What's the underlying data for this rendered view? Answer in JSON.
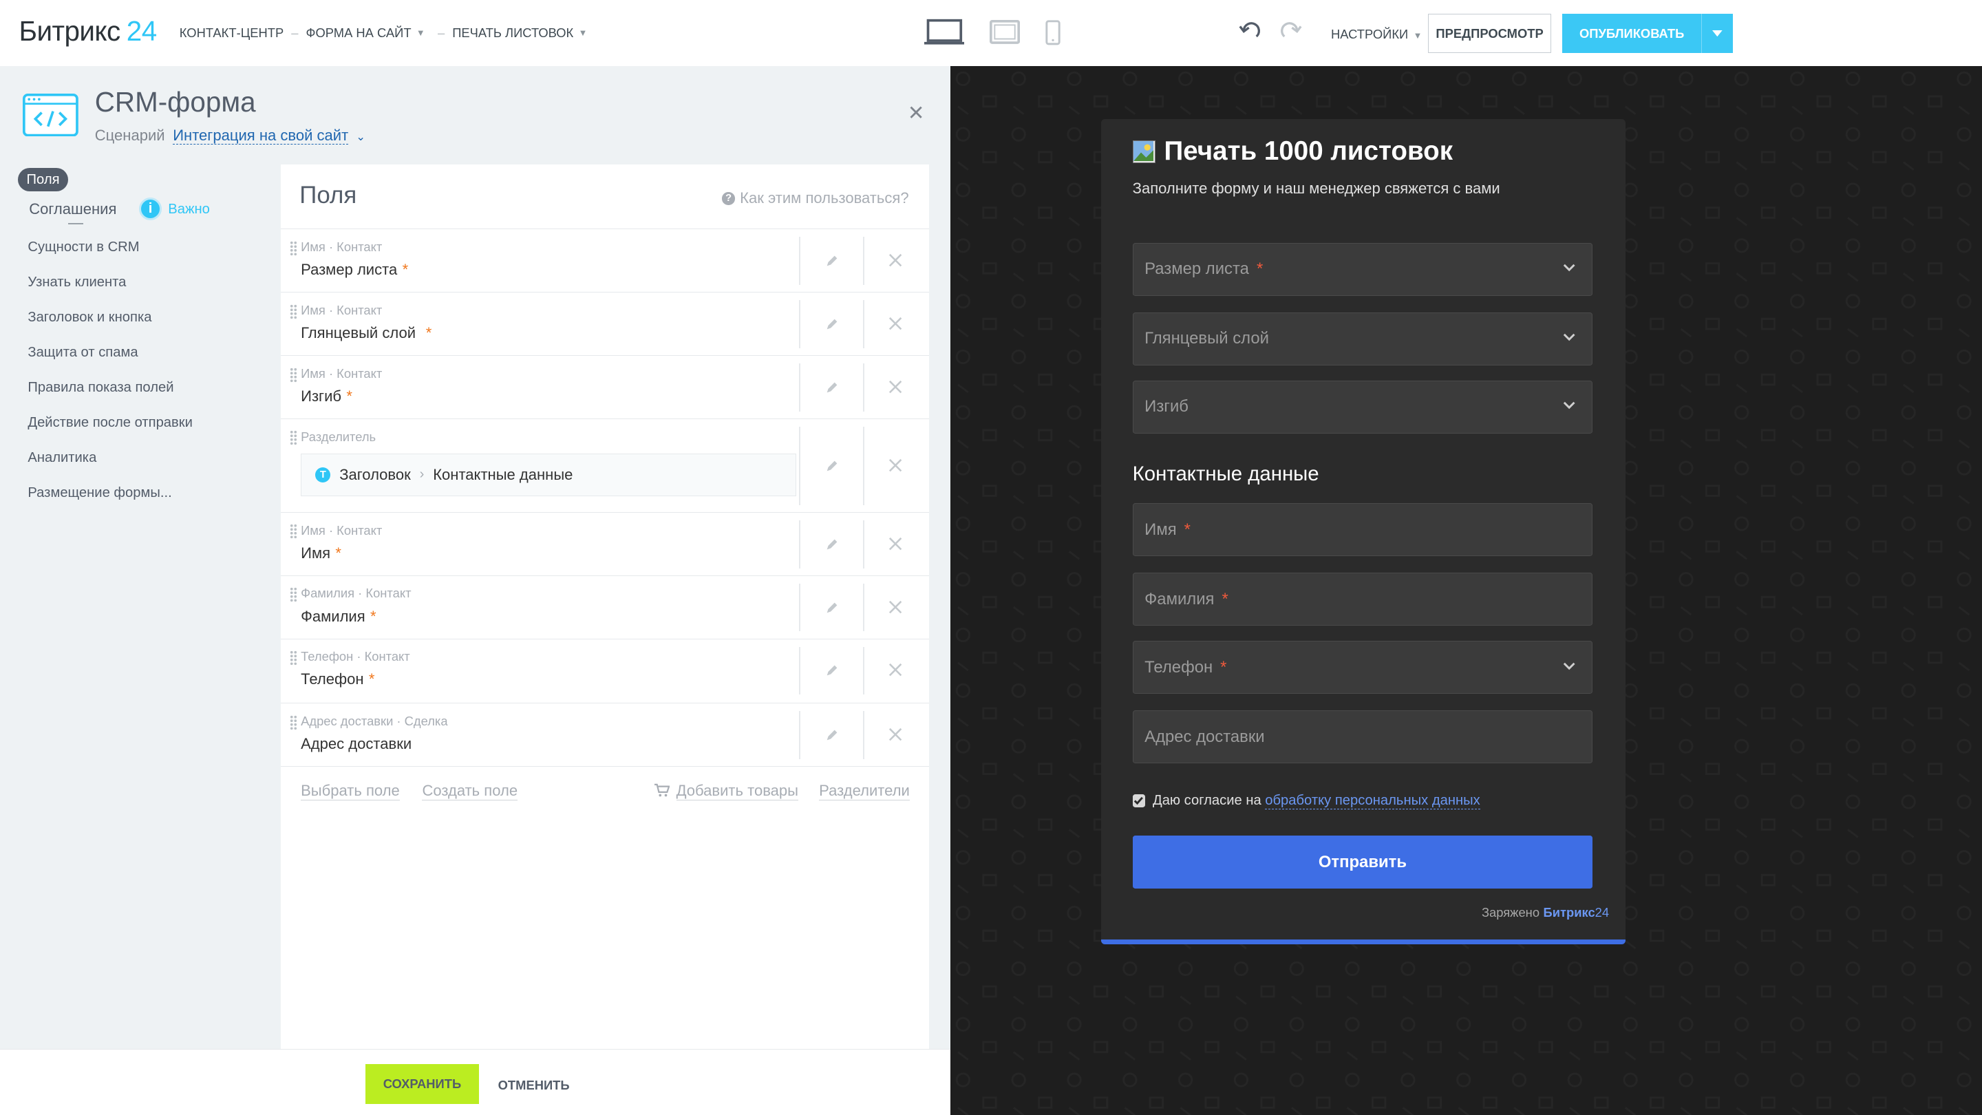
{
  "topbar": {
    "logo_text": "Битрикс",
    "logo_num": "24",
    "breadcrumbs": [
      "КОНТАКТ-ЦЕНТР",
      "ФОРМА НА САЙТ",
      "ПЕЧАТЬ ЛИСТОВОК"
    ],
    "settings_label": "НАСТРОЙКИ",
    "preview_label": "ПРЕДПРОСМОТР",
    "publish_label": "ОПУБЛИКОВАТЬ",
    "devices": [
      "laptop-icon",
      "tablet-icon",
      "phone-icon"
    ]
  },
  "editor": {
    "title": "CRM-форма",
    "scenario_label": "Сценарий",
    "scenario_value": "Интеграция на свой сайт",
    "nav": {
      "active": "Поля",
      "agreements": "Соглашения",
      "important": "Важно",
      "items": [
        "Сущности в CRM",
        "Узнать клиента",
        "Заголовок и кнопка",
        "Защита от спама",
        "Правила показа полей",
        "Действие после отправки",
        "Аналитика",
        "Размещение формы..."
      ]
    },
    "fields_title": "Поля",
    "help_text": "Как этим пользоваться?",
    "fields": [
      {
        "meta": "Имя · Контакт",
        "name": "Размер листа",
        "required": "*"
      },
      {
        "meta": "Имя · Контакт",
        "name": "Глянцевый слой",
        "required": "*"
      },
      {
        "meta": "Имя · Контакт",
        "name": "Изгиб",
        "required": "*"
      }
    ],
    "separator": {
      "meta": "Разделитель",
      "badge": "T",
      "type": "Заголовок",
      "value": "Контактные данные"
    },
    "fields2": [
      {
        "meta": "Имя · Контакт",
        "name": "Имя",
        "required": "*"
      },
      {
        "meta": "Фамилия · Контакт",
        "name": "Фамилия",
        "required": "*"
      },
      {
        "meta": "Телефон · Контакт",
        "name": "Телефон",
        "required": "*"
      },
      {
        "meta": "Адрес доставки · Сделка",
        "name": "Адрес доставки",
        "required": ""
      }
    ],
    "footer_links": {
      "select": "Выбрать поле",
      "create": "Создать поле",
      "products": "Добавить товары",
      "separators": "Разделители"
    },
    "save_label": "СОХРАНИТЬ",
    "cancel_label": "ОТМЕНИТЬ"
  },
  "preview": {
    "title": "Печать 1000 листовок",
    "subtitle": "Заполните форму и наш менеджер свяжется с вами",
    "inputs_top": [
      {
        "placeholder": "Размер листа",
        "required": "*",
        "dropdown": true
      },
      {
        "placeholder": "Глянцевый слой",
        "required": "",
        "dropdown": true
      },
      {
        "placeholder": "Изгиб",
        "required": "",
        "dropdown": true
      }
    ],
    "section_heading": "Контактные данные",
    "inputs_contact": [
      {
        "placeholder": "Имя",
        "required": "*",
        "dropdown": false
      },
      {
        "placeholder": "Фамилия",
        "required": "*",
        "dropdown": false
      },
      {
        "placeholder": "Телефон",
        "required": "*",
        "dropdown": true
      },
      {
        "placeholder": "Адрес доставки",
        "required": "",
        "dropdown": false
      }
    ],
    "consent_text": "Даю согласие на",
    "consent_link": "обработку персональных данных",
    "submit_label": "Отправить",
    "powered_text": "Заряжено",
    "powered_brand": "Битрикс",
    "powered_num": "24"
  },
  "colors": {
    "accent": "#2fc6f6",
    "save": "#bbed21",
    "submit": "#3e6ee5",
    "required": "#f0781e"
  }
}
